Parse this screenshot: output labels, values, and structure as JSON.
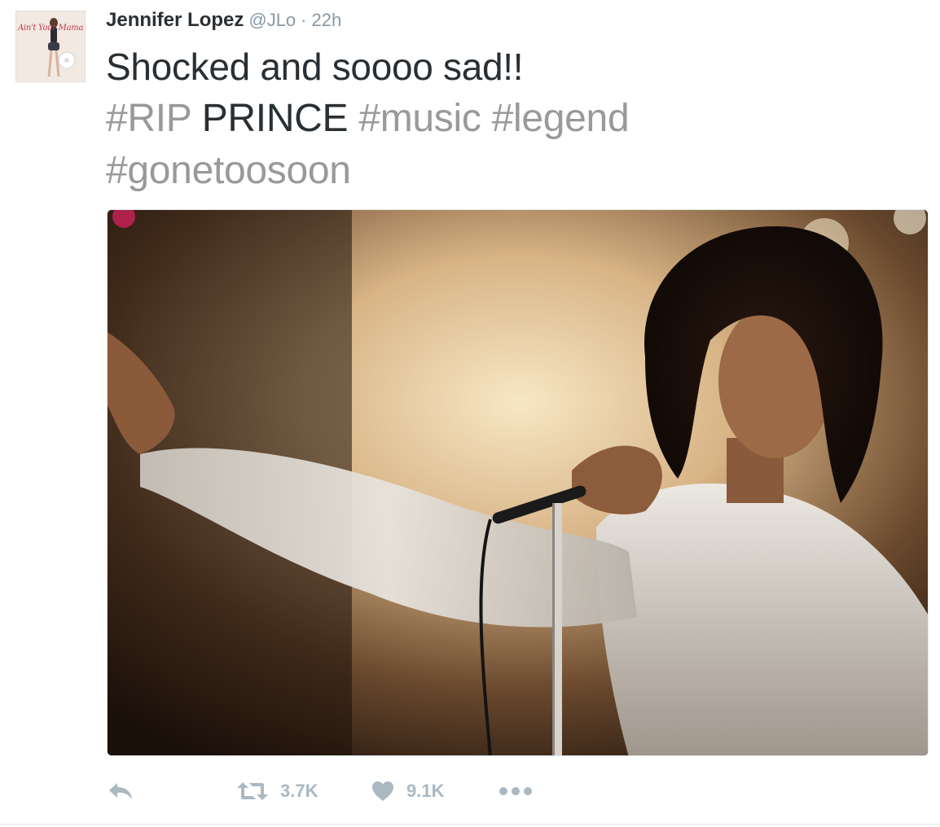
{
  "tweet": {
    "author_name": "Jennifer Lopez",
    "handle": "@JLo",
    "separator": "·",
    "time": "22h",
    "avatar": {
      "caption": "Ain't Your Mama"
    },
    "text": {
      "line1": "Shocked and soooo sad!!",
      "hashtag_rip": "#RIP",
      "prince": "PRINCE",
      "hashtag_music": "#music",
      "hashtag_legend": "#legend",
      "hashtag_gonetoosoon": "#gonetoosoon"
    },
    "media": {
      "description_icon": "photo"
    },
    "actions": {
      "reply_icon": "reply-icon",
      "retweet_icon": "retweet-icon",
      "retweet_count": "3.7K",
      "like_icon": "heart-icon",
      "like_count": "9.1K",
      "more_icon": "more-icon"
    }
  },
  "colors": {
    "text": "#292f33",
    "muted": "#8899a6",
    "hashtag": "#999999",
    "action": "#aab8c2",
    "border": "#e1e8ed"
  }
}
